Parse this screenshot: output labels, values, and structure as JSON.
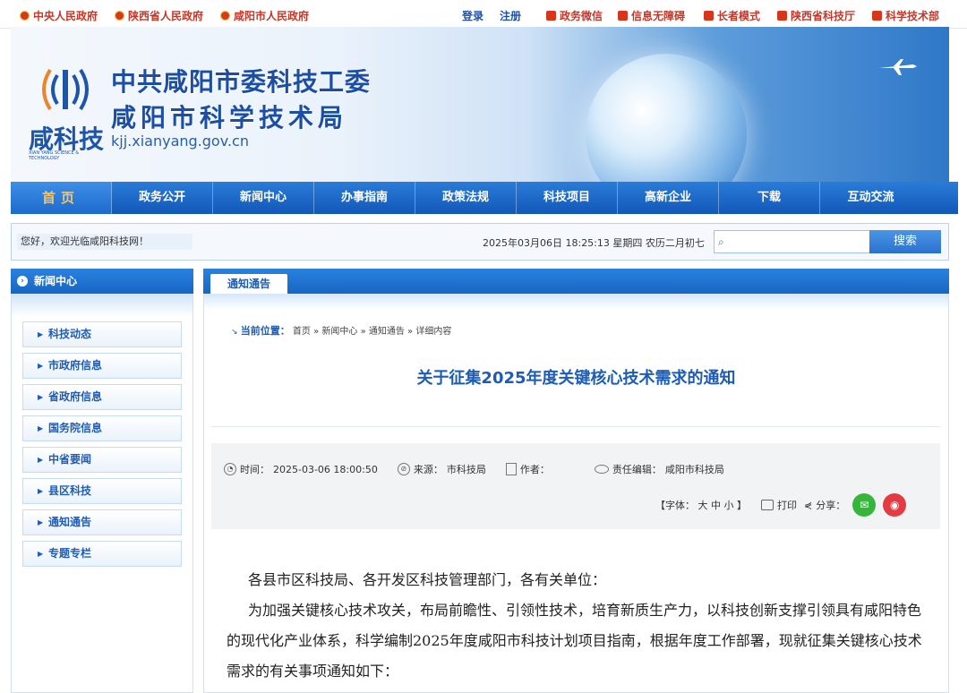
{
  "topbar": {
    "left_links": [
      "中央人民政府",
      "陕西省人民政府",
      "咸阳市人民政府"
    ],
    "login": "登录",
    "register": "注册",
    "right_links": [
      "政务微信",
      "信息无障碍",
      "长者模式",
      "陕西省科技厅",
      "科学技术部"
    ]
  },
  "banner": {
    "logo_text": "咸科技",
    "logo_sub": "XIAN YANG SCIENCE & TECHNOLOGY",
    "title1": "中共咸阳市委科技工委",
    "title2": "咸阳市科学技术局",
    "domain": "kjj.xianyang.gov.cn"
  },
  "nav": {
    "items": [
      "首页",
      "政务公开",
      "新闻中心",
      "办事指南",
      "政策法规",
      "科技项目",
      "高新企业",
      "下载",
      "互动交流"
    ]
  },
  "welcome": {
    "text": "您好，欢迎光临咸阳科技网！",
    "datetime": "2025年03月06日 18:25:13 星期四 农历二月初七",
    "search_placeholder": "",
    "search_button": "搜索"
  },
  "sidebar": {
    "title": "新闻中心",
    "items": [
      "科技动态",
      "市政府信息",
      "省政府信息",
      "国务院信息",
      "中省要闻",
      "县区科技",
      "通知通告",
      "专题专栏"
    ]
  },
  "main": {
    "tab": "通知通告",
    "breadcrumb_label": "当前位置：",
    "breadcrumb": "首页 » 新闻中心 » 通知通告 » 详细内容",
    "title": "关于征集2025年度关键核心技术需求的通知",
    "meta": {
      "time_label": "时间：",
      "time_value": "2025-03-06 18:00:50",
      "source_label": "来源：",
      "source_value": "市科技局",
      "author_label": "作者：",
      "author_value": "",
      "editor_label": "责任编辑：",
      "editor_value": "咸阳市科技局",
      "font_label": "【字体：",
      "font_sizes": [
        "大",
        "中",
        "小"
      ],
      "font_close": "】",
      "print": "打印",
      "share": "分享："
    },
    "paragraphs": [
      "各县市区科技局、各开发区科技管理部门，各有关单位：",
      "为加强关键核心技术攻关，布局前瞻性、引领性技术，培育新质生产力，以科技创新支撑引领具有咸阳特色的现代化产业体系，科学编制2025年度咸阳市科技计划项目指南，根据年度工作部署，现就征集关键核心技术需求的有关事项通知如下："
    ]
  }
}
